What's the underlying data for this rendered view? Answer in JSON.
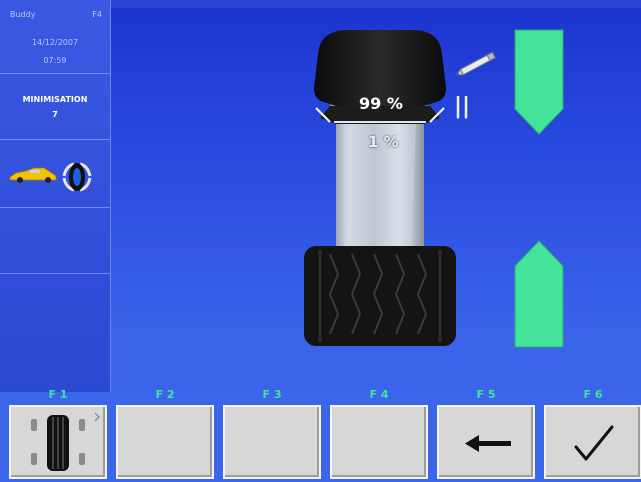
{
  "sidebar": {
    "info": {
      "line1_left": "Buddy",
      "line1_right": "F4",
      "date": "14/12/2007",
      "time": "07:59"
    },
    "mode": {
      "title": "MINIMISATION",
      "step": "7"
    },
    "vehicle_icons": [
      "car-icon",
      "wheel-rotation-icon"
    ]
  },
  "display": {
    "top_percent": "99 %",
    "bottom_percent": "1 %",
    "pause_symbol": "||",
    "arrow_color": "#44e39a"
  },
  "function_keys": [
    {
      "label": "F 1",
      "icon": "tire-position-icon"
    },
    {
      "label": "F 2",
      "icon": ""
    },
    {
      "label": "F 3",
      "icon": ""
    },
    {
      "label": "F 4",
      "icon": ""
    },
    {
      "label": "F 5",
      "icon": "arrow-left-icon"
    },
    {
      "label": "F 6",
      "icon": "checkmark-icon"
    }
  ]
}
